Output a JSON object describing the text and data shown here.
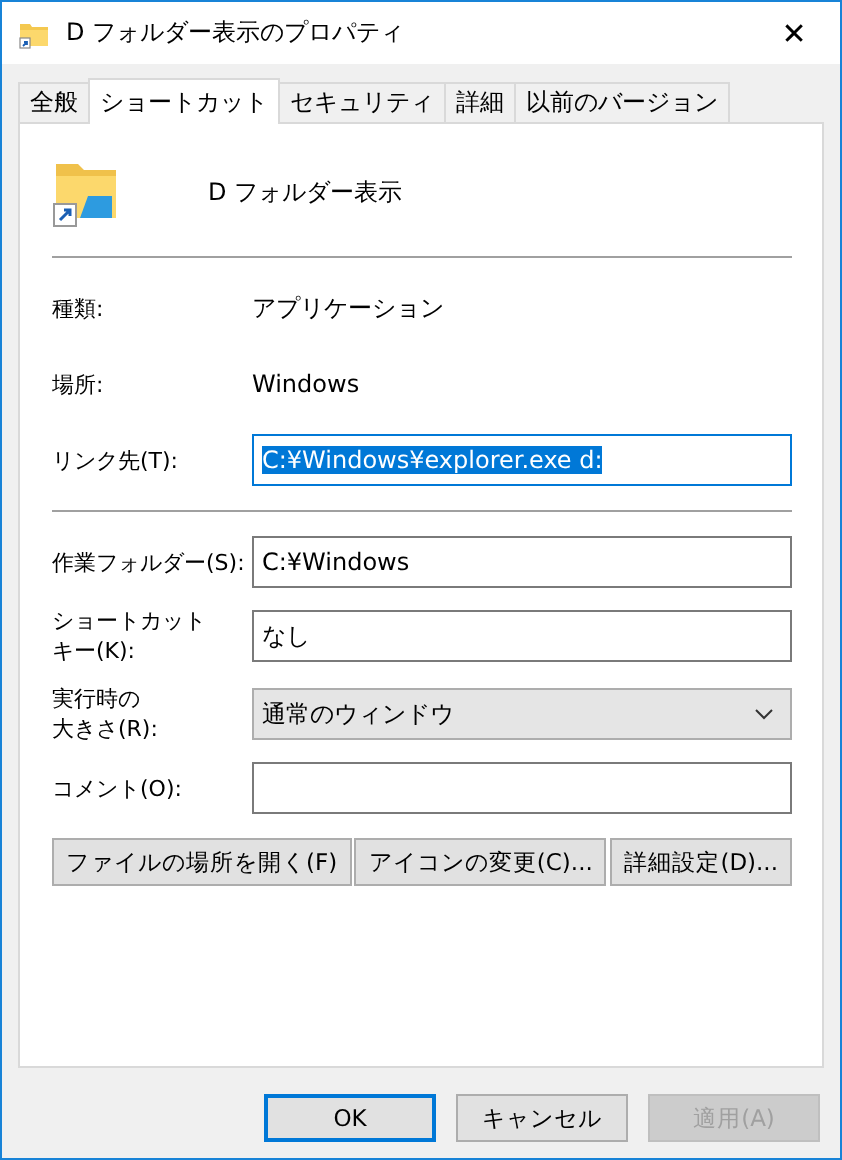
{
  "window": {
    "title": "D フォルダー表示のプロパティ",
    "close": "✕"
  },
  "tabs": [
    {
      "label": "全般",
      "selected": false
    },
    {
      "label": "ショートカット",
      "selected": true
    },
    {
      "label": "セキュリティ",
      "selected": false
    },
    {
      "label": "詳細",
      "selected": false
    },
    {
      "label": "以前のバージョン",
      "selected": false
    }
  ],
  "shortcut_name": "D フォルダー表示",
  "info": [
    {
      "label": "種類:",
      "value": "アプリケーション"
    },
    {
      "label": "場所:",
      "value": "Windows"
    }
  ],
  "target": {
    "label": "リンク先(T):",
    "value": "C:¥Windows¥explorer.exe d:",
    "text_selected": true
  },
  "fields": [
    {
      "kind": "text",
      "label": [
        "作業フォルダー(S):"
      ],
      "value": "C:¥Windows"
    },
    {
      "kind": "text",
      "label": [
        "ショートカット",
        "キー(K):"
      ],
      "value": "なし"
    },
    {
      "kind": "select",
      "label": [
        "実行時の",
        "大きさ(R):"
      ],
      "value": "通常のウィンドウ"
    },
    {
      "kind": "text",
      "label": [
        "コメント(O):"
      ]
    }
  ],
  "actions": [
    "ファイルの場所を開く(F)",
    "アイコンの変更(C)...",
    "詳細設定(D)..."
  ],
  "buttons": [
    {
      "label": "OK",
      "default": true,
      "disabled": false
    },
    {
      "label": "キャンセル",
      "default": false,
      "disabled": false
    },
    {
      "label": "適用(A)",
      "default": false,
      "disabled": true
    }
  ]
}
